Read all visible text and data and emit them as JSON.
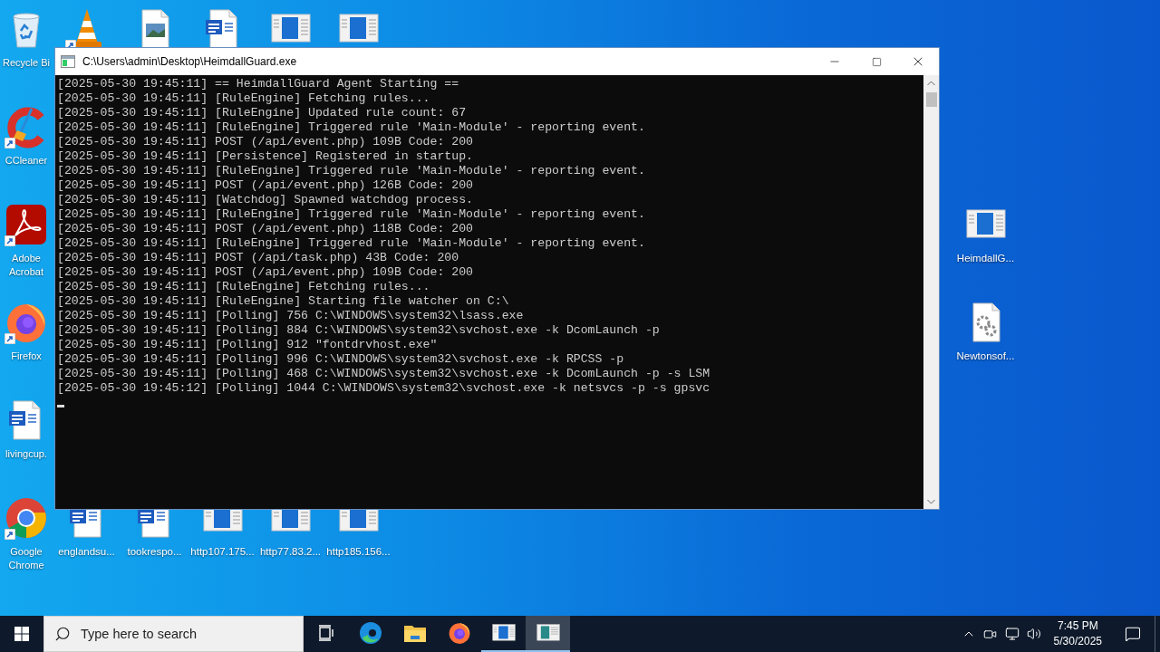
{
  "window": {
    "title": "C:\\Users\\admin\\Desktop\\HeimdallGuard.exe",
    "console_lines": [
      "[2025-05-30 19:45:11] == HeimdallGuard Agent Starting ==",
      "[2025-05-30 19:45:11] [RuleEngine] Fetching rules...",
      "[2025-05-30 19:45:11] [RuleEngine] Updated rule count: 67",
      "[2025-05-30 19:45:11] [RuleEngine] Triggered rule 'Main-Module' - reporting event.",
      "[2025-05-30 19:45:11] POST (/api/event.php) 109B Code: 200",
      "[2025-05-30 19:45:11] [Persistence] Registered in startup.",
      "[2025-05-30 19:45:11] [RuleEngine] Triggered rule 'Main-Module' - reporting event.",
      "[2025-05-30 19:45:11] POST (/api/event.php) 126B Code: 200",
      "[2025-05-30 19:45:11] [Watchdog] Spawned watchdog process.",
      "[2025-05-30 19:45:11] [RuleEngine] Triggered rule 'Main-Module' - reporting event.",
      "[2025-05-30 19:45:11] POST (/api/event.php) 118B Code: 200",
      "[2025-05-30 19:45:11] [RuleEngine] Triggered rule 'Main-Module' - reporting event.",
      "[2025-05-30 19:45:11] POST (/api/task.php) 43B Code: 200",
      "[2025-05-30 19:45:11] POST (/api/event.php) 109B Code: 200",
      "[2025-05-30 19:45:11] [RuleEngine] Fetching rules...",
      "[2025-05-30 19:45:11] [RuleEngine] Starting file watcher on C:\\",
      "[2025-05-30 19:45:11] [Polling] 756 C:\\WINDOWS\\system32\\lsass.exe",
      "[2025-05-30 19:45:11] [Polling] 884 C:\\WINDOWS\\system32\\svchost.exe -k DcomLaunch -p",
      "[2025-05-30 19:45:11] [Polling] 912 \"fontdrvhost.exe\"",
      "[2025-05-30 19:45:11] [Polling] 996 C:\\WINDOWS\\system32\\svchost.exe -k RPCSS -p",
      "[2025-05-30 19:45:11] [Polling] 468 C:\\WINDOWS\\system32\\svchost.exe -k DcomLaunch -p -s LSM",
      "[2025-05-30 19:45:12] [Polling] 1044 C:\\WINDOWS\\system32\\svchost.exe -k netsvcs -p -s gpsvc"
    ]
  },
  "left_column": [
    {
      "kind": "recycle",
      "label": "Recycle Bi",
      "shortcut": false
    },
    {
      "kind": "ccleaner",
      "label": "CCleaner",
      "shortcut": true
    },
    {
      "kind": "acrobat",
      "label": "Adobe Acrobat",
      "shortcut": true
    },
    {
      "kind": "firefox",
      "label": "Firefox",
      "shortcut": true
    },
    {
      "kind": "word",
      "label": "livingcup.",
      "shortcut": false
    },
    {
      "kind": "chrome",
      "label": "Google Chrome",
      "shortcut": true
    }
  ],
  "top_row": [
    {
      "kind": "vlc",
      "shortcut": true
    },
    {
      "kind": "image",
      "shortcut": false
    },
    {
      "kind": "word",
      "shortcut": false
    },
    {
      "kind": "app",
      "shortcut": false
    },
    {
      "kind": "app",
      "shortcut": false
    }
  ],
  "bottom_row": [
    {
      "kind": "word",
      "label": "englandsu...",
      "shortcut": false
    },
    {
      "kind": "word",
      "label": "tookrespo...",
      "shortcut": false
    },
    {
      "kind": "app",
      "label": "http107.175...",
      "shortcut": false
    },
    {
      "kind": "app",
      "label": "http77.83.2...",
      "shortcut": false
    },
    {
      "kind": "app",
      "label": "http185.156...",
      "shortcut": false
    }
  ],
  "right_column": [
    {
      "kind": "app",
      "label": "HeimdallG...",
      "shortcut": false
    },
    {
      "kind": "settings-file",
      "label": "Newtonsof...",
      "shortcut": false
    }
  ],
  "taskbar": {
    "search": {
      "placeholder": "Type here to search"
    },
    "apps": [
      {
        "kind": "task-view",
        "running": false,
        "selected": false
      },
      {
        "kind": "edge",
        "running": false,
        "selected": false
      },
      {
        "kind": "explorer",
        "running": false,
        "selected": false
      },
      {
        "kind": "firefox",
        "running": false,
        "selected": false
      },
      {
        "kind": "app",
        "running": true,
        "selected": false
      },
      {
        "kind": "console",
        "running": true,
        "selected": true
      }
    ],
    "clock": {
      "time": "7:45 PM",
      "date": "5/30/2025"
    }
  }
}
